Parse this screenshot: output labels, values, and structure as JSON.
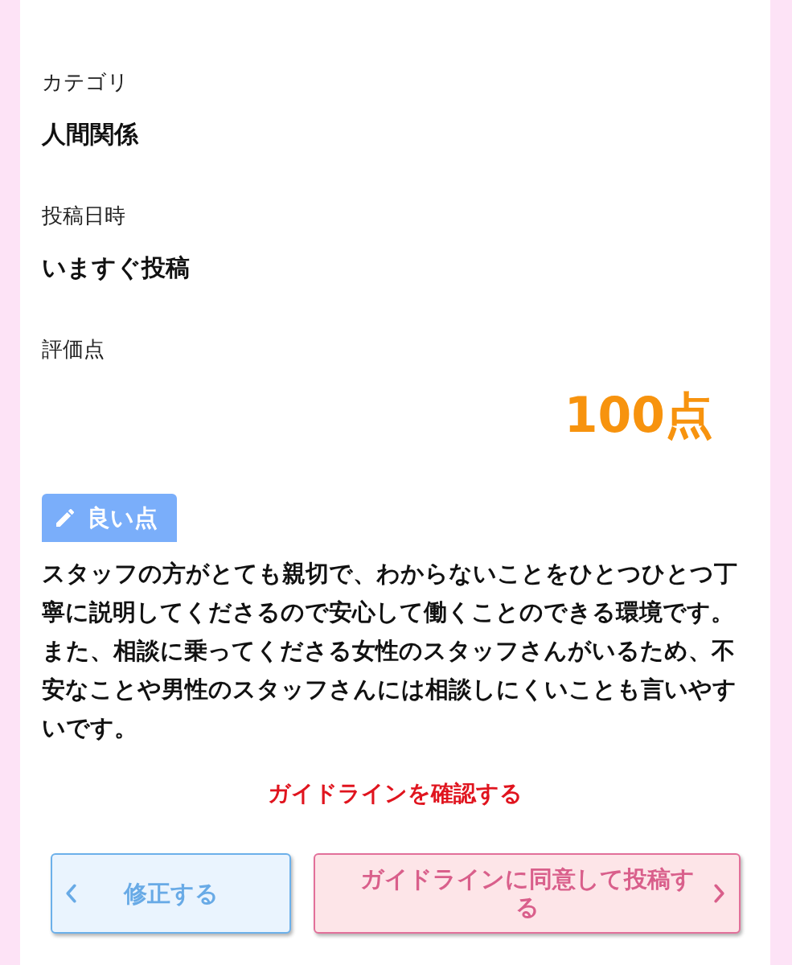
{
  "fields": [
    {
      "label": "カテゴリ",
      "value": "人間関係"
    },
    {
      "label": "投稿日時",
      "value": "いますぐ投稿"
    }
  ],
  "rating": {
    "label": "評価点",
    "score": "100点"
  },
  "review": {
    "tag": "良い点",
    "text": "スタッフの方がとても親切で、わからないことをひとつひとつ丁寧に説明してくださるので安心して働くことのできる環境です。また、相談に乗ってくださる女性のスタッフさんがいるため、不安なことや男性のスタッフさんには相談しにくいことも言いやすいです。"
  },
  "guideline_link": "ガイドラインを確認する",
  "buttons": [
    {
      "kind": "back",
      "label": "修正する"
    },
    {
      "kind": "submit",
      "label": "ガイドラインに同意して投稿する"
    }
  ]
}
